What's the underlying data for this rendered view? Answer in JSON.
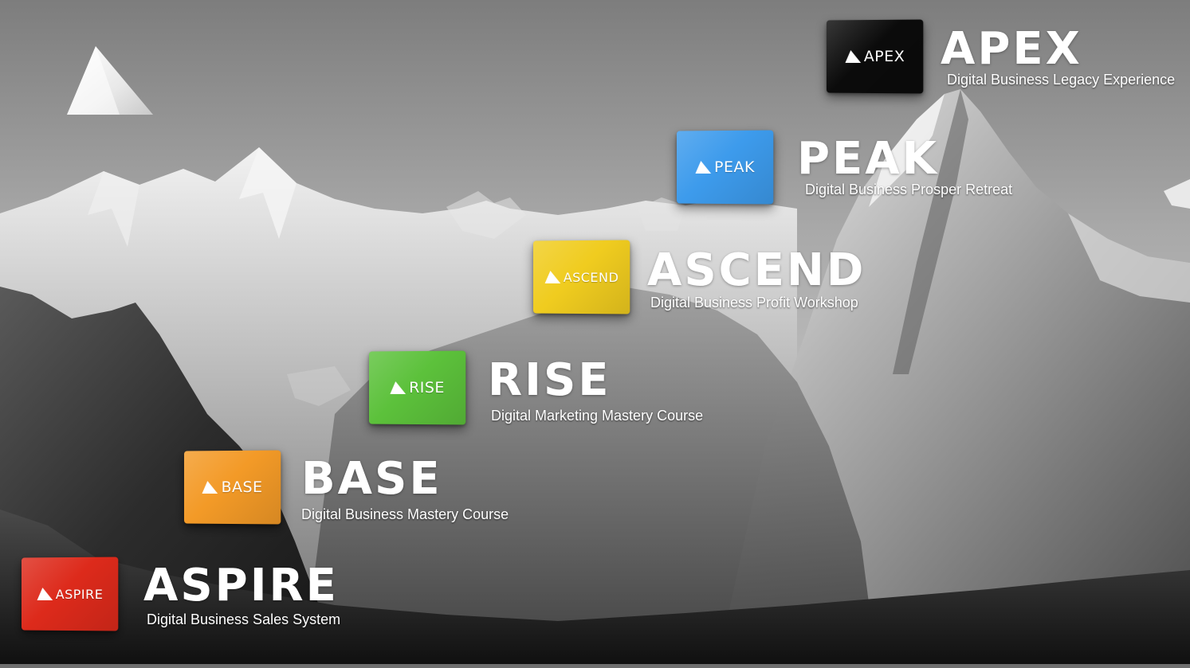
{
  "brand": {
    "logo_icon": "triangle-logo-icon"
  },
  "colors": {
    "apex": "#0b0b0b",
    "peak": "#3d9bec",
    "ascend": "#f0cc1f",
    "rise": "#5cc13b",
    "base": "#f39a27",
    "aspire": "#dd2a1b",
    "text": "#ffffff"
  },
  "tiers": [
    {
      "card_label": "APEX",
      "name": "APEX",
      "subtitle": "Digital Business Legacy Experience"
    },
    {
      "card_label": "PEAK",
      "name": "PEAK",
      "subtitle": "Digital Business Prosper Retreat"
    },
    {
      "card_label": "ASCEND",
      "name": "ASCEND",
      "subtitle": "Digital Business Profit Workshop"
    },
    {
      "card_label": "RISE",
      "name": "RISE",
      "subtitle": "Digital Marketing Mastery Course"
    },
    {
      "card_label": "BASE",
      "name": "BASE",
      "subtitle": "Digital Business Mastery Course"
    },
    {
      "card_label": "ASPIRE",
      "name": "ASPIRE",
      "subtitle": "Digital Business Sales System"
    }
  ]
}
